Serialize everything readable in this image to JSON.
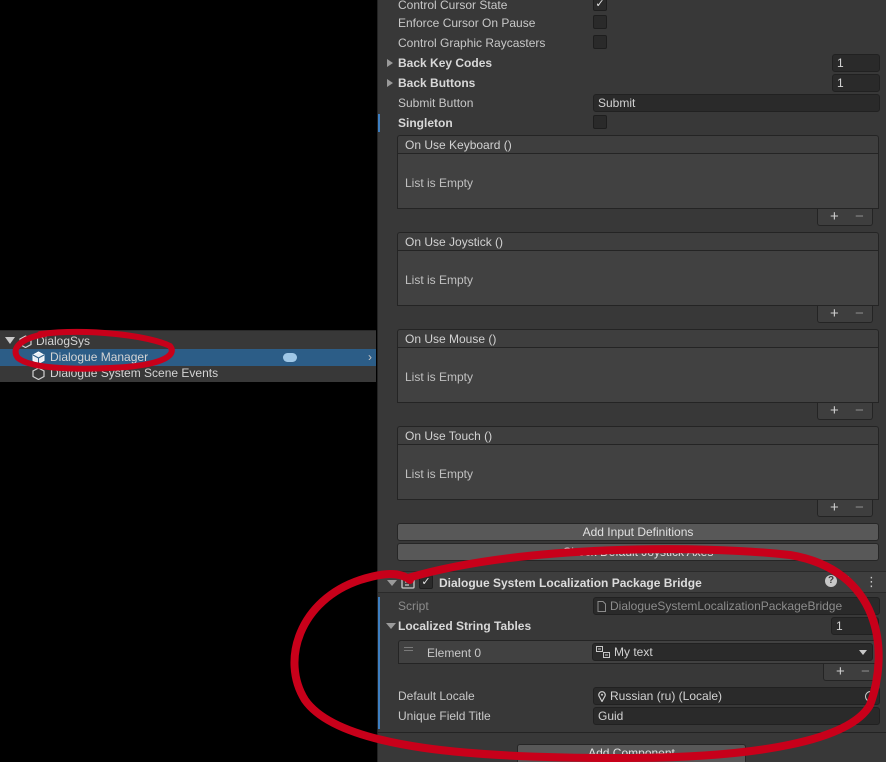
{
  "hierarchy": {
    "items": [
      {
        "label": "DialogSys"
      },
      {
        "label": "Dialogue Manager"
      },
      {
        "label": "Dialogue System Scene Events"
      }
    ]
  },
  "inspector": {
    "rows": {
      "control_cursor": "Control Cursor State",
      "enforce_cursor": "Enforce Cursor On Pause",
      "control_raycasters": "Control Graphic Raycasters",
      "back_key_codes": "Back Key Codes",
      "back_key_codes_count": "1",
      "back_buttons": "Back Buttons",
      "back_buttons_count": "1",
      "submit_button": "Submit Button",
      "submit_button_value": "Submit",
      "singleton": "Singleton"
    },
    "events": [
      {
        "title": "On Use Keyboard ()",
        "empty": "List is Empty"
      },
      {
        "title": "On Use Joystick ()",
        "empty": "List is Empty"
      },
      {
        "title": "On Use Mouse ()",
        "empty": "List is Empty"
      },
      {
        "title": "On Use Touch ()",
        "empty": "List is Empty"
      }
    ],
    "buttons": {
      "add_input": "Add Input Definitions",
      "check_axes": "Check Default Joystick Axes",
      "add_component": "Add Component"
    },
    "component": {
      "title": "Dialogue System Localization Package Bridge",
      "script_label": "Script",
      "script_value": "DialogueSystemLocalizationPackageBridge",
      "tables_label": "Localized String Tables",
      "tables_count": "1",
      "element_label": "Element 0",
      "element_value": "My text",
      "locale_label": "Default Locale",
      "locale_value": "Russian (ru) (Locale)",
      "unique_label": "Unique Field Title",
      "unique_value": "Guid"
    },
    "symbols": {
      "plus": "+",
      "minus": "−",
      "check": "✓",
      "help": "?",
      "kebab": "⋮",
      "chevron": "›"
    }
  }
}
